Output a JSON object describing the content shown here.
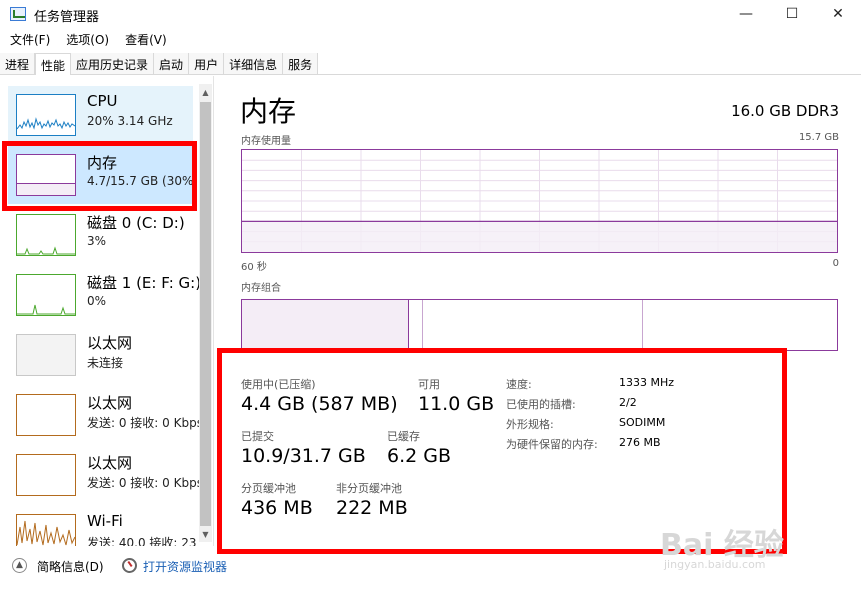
{
  "window": {
    "title": "任务管理器",
    "controls": {
      "minimize": "—",
      "maximize": "☐",
      "close": "✕"
    }
  },
  "menu": [
    {
      "label": "文件(F)"
    },
    {
      "label": "选项(O)"
    },
    {
      "label": "查看(V)"
    }
  ],
  "tabs": [
    {
      "label": "进程"
    },
    {
      "label": "性能",
      "active": true
    },
    {
      "label": "应用历史记录"
    },
    {
      "label": "启动"
    },
    {
      "label": "用户"
    },
    {
      "label": "详细信息"
    },
    {
      "label": "服务"
    }
  ],
  "sidebar": {
    "items": [
      {
        "name": "CPU",
        "sub": "20% 3.14 GHz",
        "icon": "cpu-graph-icon"
      },
      {
        "name": "内存",
        "sub": "4.7/15.7 GB (30%)",
        "icon": "memory-graph-icon",
        "selected": true
      },
      {
        "name": "磁盘 0 (C: D:)",
        "sub": "3%",
        "icon": "disk-graph-icon"
      },
      {
        "name": "磁盘 1 (E: F: G:)",
        "sub": "0%",
        "icon": "disk-graph-icon"
      },
      {
        "name": "以太网",
        "sub": "未连接",
        "icon": "ethernet-graph-icon"
      },
      {
        "name": "以太网",
        "sub": "发送: 0 接收: 0 Kbps",
        "icon": "ethernet-graph-icon"
      },
      {
        "name": "以太网",
        "sub": "发送: 0 接收: 0 Kbps",
        "icon": "ethernet-graph-icon"
      },
      {
        "name": "Wi-Fi",
        "sub": "发送: 40.0 接收: 23",
        "icon": "wifi-graph-icon"
      }
    ]
  },
  "main": {
    "title": "内存",
    "spec": "16.0 GB DDR3",
    "usage_graph": {
      "label": "内存使用量",
      "max": "15.7 GB",
      "left_time": "60 秒",
      "right_time": "0",
      "used_fraction": 0.3
    },
    "composition": {
      "label": "内存组合"
    },
    "stats": {
      "in_use": {
        "label": "使用中(已压缩)",
        "value": "4.4 GB (587 MB)"
      },
      "available": {
        "label": "可用",
        "value": "11.0 GB"
      },
      "committed": {
        "label": "已提交",
        "value": "10.9/31.7 GB"
      },
      "cached": {
        "label": "已缓存",
        "value": "6.2 GB"
      },
      "paged_pool": {
        "label": "分页缓冲池",
        "value": "436 MB"
      },
      "nonpaged_pool": {
        "label": "非分页缓冲池",
        "value": "222 MB"
      }
    },
    "details": [
      {
        "label": "速度:",
        "value": "1333 MHz"
      },
      {
        "label": "已使用的插槽:",
        "value": "2/2"
      },
      {
        "label": "外形规格:",
        "value": "SODIMM"
      },
      {
        "label": "为硬件保留的内存:",
        "value": "276 MB"
      }
    ]
  },
  "footer": {
    "summary": "简略信息(D)",
    "resource_monitor": "打开资源监视器"
  },
  "colors": {
    "memory": "#8b3a9c",
    "cpu": "#1c7fc4",
    "disk": "#4ca82e",
    "ethernet": "#b36b1e",
    "highlight": "#ff0000"
  },
  "watermark": {
    "main": "Bai 经验",
    "sub": "jingyan.baidu.com"
  }
}
